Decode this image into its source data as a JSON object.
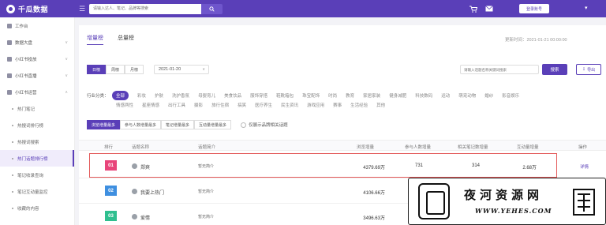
{
  "header": {
    "brand": "千瓜数据",
    "search_placeholder": "请输入达人、笔记、品牌等搜索",
    "login_label": "登录账号",
    "colors": {
      "bar": "#5a3fb8",
      "accent": "#5a3fb8"
    }
  },
  "sidebar": {
    "items": [
      {
        "type": "item",
        "label": "工作台",
        "icon": "dashboard-icon"
      },
      {
        "type": "item",
        "label": "数据大盘",
        "icon": "chart-icon",
        "caret": "∨"
      },
      {
        "type": "item",
        "label": "小红书投放",
        "icon": "target-icon",
        "caret": "∨"
      },
      {
        "type": "item",
        "label": "小红书直播",
        "icon": "live-icon",
        "caret": "∨"
      },
      {
        "type": "item",
        "label": "小红书运营",
        "icon": "operate-icon",
        "caret": "∧"
      },
      {
        "type": "sub",
        "label": "热门笔记"
      },
      {
        "type": "sub",
        "label": "热搜词排行榜"
      },
      {
        "type": "sub",
        "label": "热搜词搜索"
      },
      {
        "type": "sub",
        "label": "热门话题排行榜",
        "active": true
      },
      {
        "type": "sub",
        "label": "笔记收录查询"
      },
      {
        "type": "sub",
        "label": "笔记互动量监控"
      },
      {
        "type": "sub",
        "label": "收藏的内容"
      }
    ]
  },
  "main": {
    "tabs": [
      {
        "label": "增量榜",
        "active": true
      },
      {
        "label": "总量榜",
        "active": false
      }
    ],
    "update_time": "更新时间：2021-01-21 00:00:00",
    "periods": [
      {
        "label": "日榜",
        "active": true
      },
      {
        "label": "周榜",
        "active": false
      },
      {
        "label": "月榜",
        "active": false
      }
    ],
    "date": "2021-01-20",
    "topic_search_placeholder": "请输入话题名称关键词搜索",
    "search_label": "搜索",
    "export_label": "导出",
    "category_label": "行业分类：",
    "categories_row1": [
      {
        "label": "全部",
        "active": true
      },
      {
        "label": "彩妆"
      },
      {
        "label": "护肤"
      },
      {
        "label": "洗护香氛"
      },
      {
        "label": "母婴育儿"
      },
      {
        "label": "美食饮品"
      },
      {
        "label": "服饰穿搭"
      },
      {
        "label": "鞋靴箱包"
      },
      {
        "label": "珠宝配饰"
      },
      {
        "label": "时尚"
      },
      {
        "label": "教育"
      },
      {
        "label": "家居家装"
      },
      {
        "label": "健身减肥"
      },
      {
        "label": "科技数码"
      },
      {
        "label": "运动"
      },
      {
        "label": "萌宠动物"
      },
      {
        "label": "婚纱"
      },
      {
        "label": "影音娱乐"
      }
    ],
    "categories_row2": [
      {
        "label": "情感两性"
      },
      {
        "label": "星座情感"
      },
      {
        "label": "出行工具"
      },
      {
        "label": "摄影"
      },
      {
        "label": "旅行住宿"
      },
      {
        "label": "搞笑"
      },
      {
        "label": "医疗养生"
      },
      {
        "label": "民生资讯"
      },
      {
        "label": "游戏应用"
      },
      {
        "label": "赛事"
      },
      {
        "label": "生活经验"
      },
      {
        "label": "其他"
      }
    ],
    "sort_buttons": [
      {
        "label": "浏览增量最多",
        "active": true
      },
      {
        "label": "参与人数增量最多",
        "active": false
      },
      {
        "label": "笔记增量最多",
        "active": false
      },
      {
        "label": "互动量增量最多",
        "active": false
      }
    ],
    "brand_only_label": "仅展示品牌相关话题",
    "table": {
      "columns": [
        "排行",
        "话题名称",
        "话题简介",
        "浏览增量",
        "参与人数增量",
        "相关笔记数增量",
        "互动量增量",
        "操作"
      ],
      "rows": [
        {
          "rank": "01",
          "rank_color": "#e8457a",
          "name": "郑爽",
          "intro": "暂无简介",
          "views": "4379.69万",
          "participants": "731",
          "notes": "314",
          "interactions": "2.68万",
          "action": "详情"
        },
        {
          "rank": "02",
          "rank_color": "#3f8fe0",
          "name": "我要上热门",
          "intro": "暂无简介",
          "views": "4106.66万",
          "participants": "",
          "notes": "",
          "interactions": "",
          "action": ""
        },
        {
          "rank": "03",
          "rank_color": "#2fbf8f",
          "name": "爱情",
          "intro": "暂无简介",
          "views": "3496.63万",
          "participants": "",
          "notes": "",
          "interactions": "",
          "action": ""
        }
      ]
    }
  },
  "watermark": {
    "title": "夜河资源网",
    "url": "WWW.YEHES.COM"
  }
}
